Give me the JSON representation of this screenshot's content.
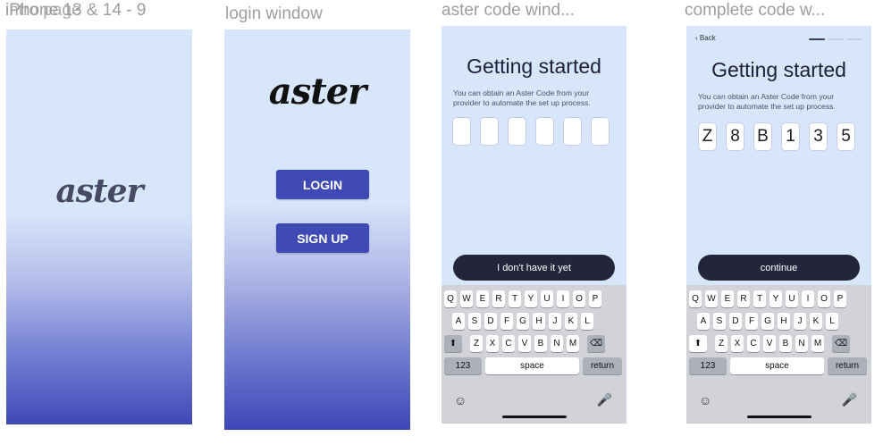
{
  "frames": [
    {
      "label": "iPhone 13 & 14 - 9",
      "label_overlay": "intro page",
      "logo": "aster"
    },
    {
      "label": "login window",
      "logo": "aster",
      "login_button": "LOGIN",
      "signup_button": "SIGN UP"
    },
    {
      "label": "aster code wind...",
      "heading": "Getting started",
      "subtitle": "You can obtain an Aster Code from your provider to automate the set up process.",
      "code": [
        "",
        "",
        "",
        "",
        "",
        ""
      ],
      "pill_button": "I don't have it yet"
    },
    {
      "label": "complete code w...",
      "back_label": "Back",
      "progress_steps": 3,
      "progress_active": 1,
      "heading": "Getting started",
      "subtitle": "You can obtain an Aster Code from your provider to automate the set up process.",
      "code": [
        "Z",
        "8",
        "B",
        "1",
        "3",
        "5"
      ],
      "pill_button": "continue"
    }
  ],
  "keyboard": {
    "row1": [
      "Q",
      "W",
      "E",
      "R",
      "T",
      "Y",
      "U",
      "I",
      "O",
      "P"
    ],
    "row2": [
      "A",
      "S",
      "D",
      "F",
      "G",
      "H",
      "J",
      "K",
      "L"
    ],
    "row3": [
      "Z",
      "X",
      "C",
      "V",
      "B",
      "N",
      "M"
    ],
    "shift_icon": "shift-arrow-icon",
    "delete_icon": "backspace-icon",
    "numbers_key": "123",
    "space_key": "space",
    "return_key": "return",
    "emoji_icon": "emoji-icon",
    "mic_icon": "microphone-icon"
  },
  "colors": {
    "brand_blue": "#3f4ab4",
    "dark_pill": "#23253a",
    "background_light": "#d8e6fb"
  }
}
